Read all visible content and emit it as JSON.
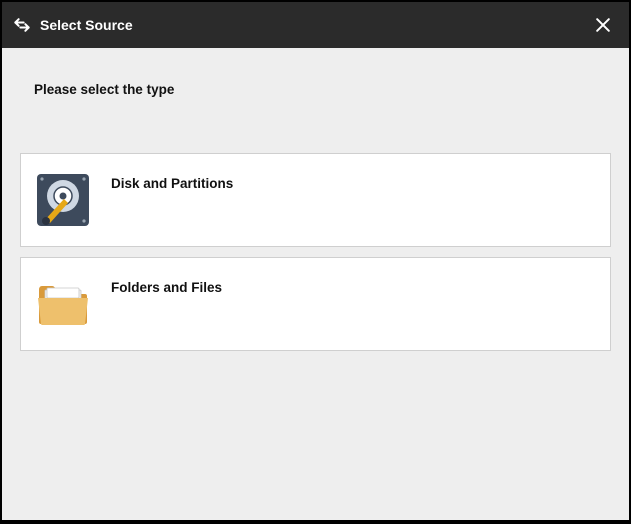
{
  "header": {
    "title": "Select Source"
  },
  "prompt": "Please select the type",
  "options": [
    {
      "label": "Disk and Partitions"
    },
    {
      "label": "Folders and Files"
    }
  ]
}
